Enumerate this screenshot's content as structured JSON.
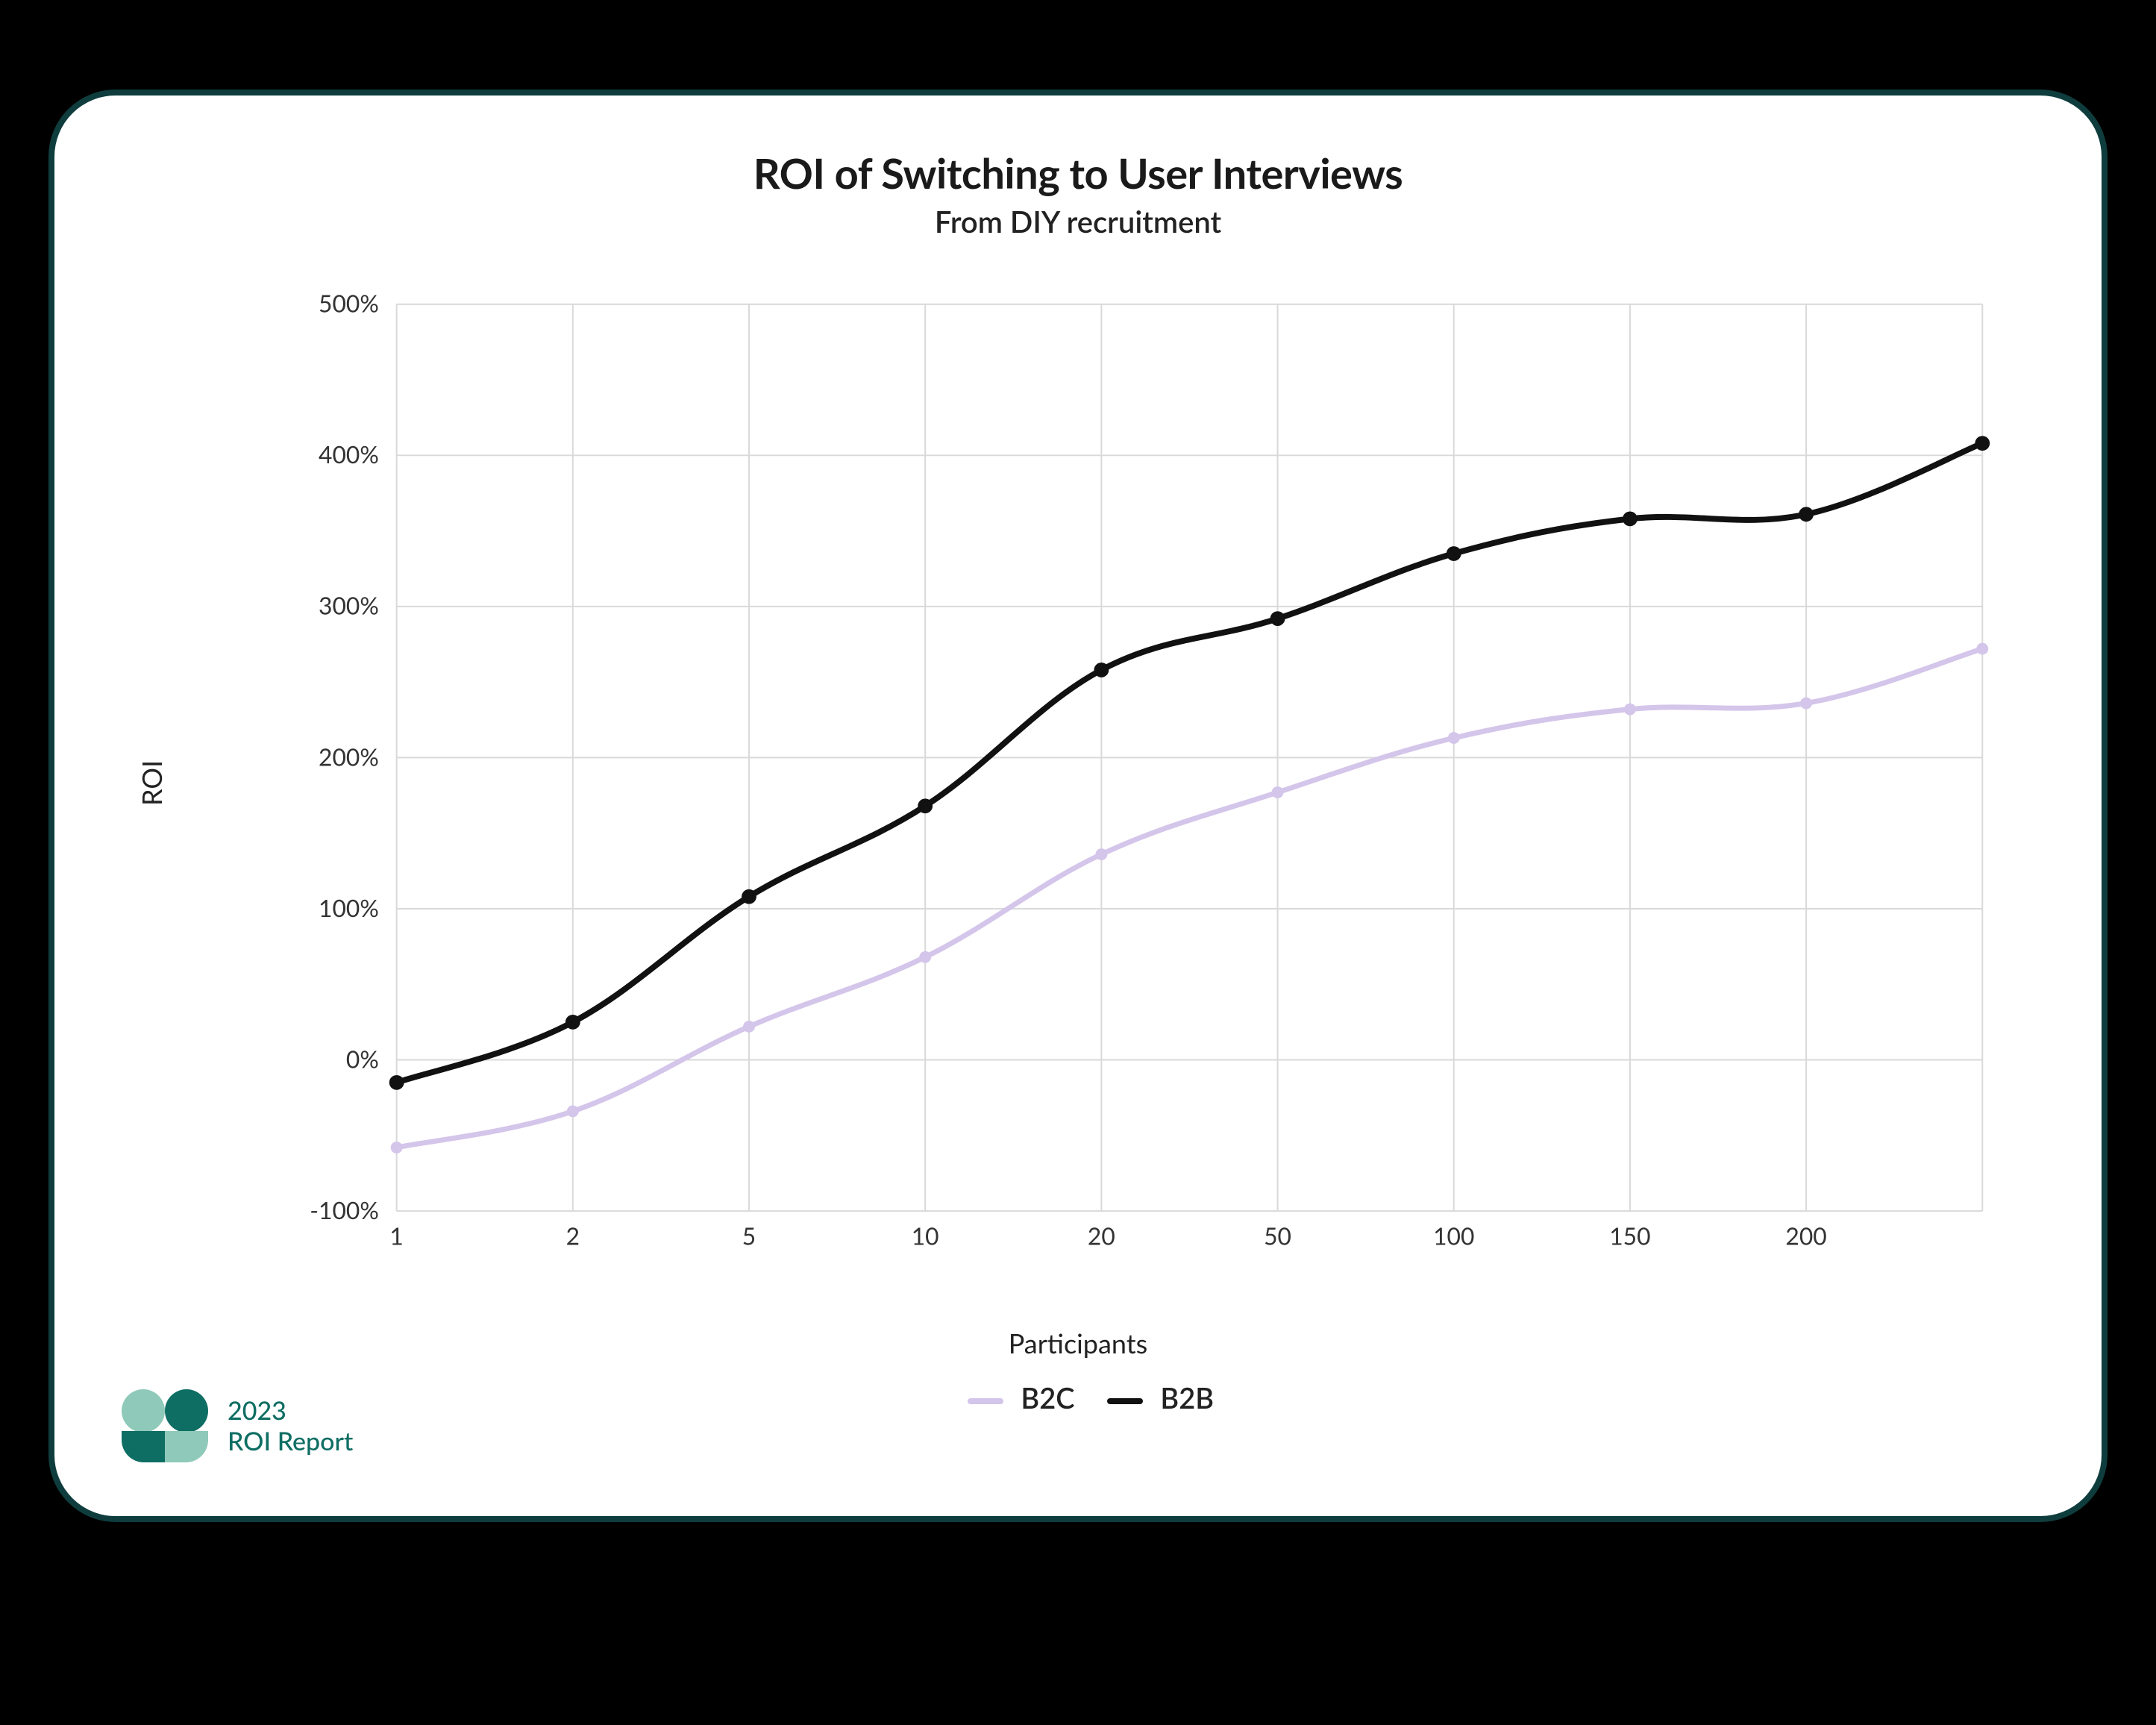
{
  "chart_data": {
    "type": "line",
    "title": "ROI of Switching to User Interviews",
    "subtitle": "From DIY recruitment",
    "xlabel": "Participants",
    "ylabel": "ROI",
    "x_ticks": [
      1,
      2,
      5,
      10,
      20,
      50,
      100,
      150,
      200
    ],
    "x_tick_labels": [
      "1",
      "2",
      "5",
      "10",
      "20",
      "50",
      "100",
      "150",
      "200"
    ],
    "y_ticks": [
      -100,
      0,
      100,
      200,
      300,
      400,
      500
    ],
    "y_tick_labels": [
      "-100%",
      "0%",
      "100%",
      "200%",
      "300%",
      "400%",
      "500%"
    ],
    "ylim": [
      -100,
      500
    ],
    "series": [
      {
        "name": "B2C",
        "color": "#d4c5ea",
        "x": [
          1,
          2,
          5,
          10,
          20,
          50,
          100,
          150,
          200,
          300
        ],
        "values": [
          -58,
          -34,
          22,
          68,
          136,
          177,
          213,
          232,
          236,
          272
        ]
      },
      {
        "name": "B2B",
        "color": "#111111",
        "x": [
          1,
          2,
          5,
          10,
          20,
          50,
          100,
          150,
          200,
          300
        ],
        "values": [
          -15,
          25,
          108,
          168,
          258,
          292,
          335,
          358,
          361,
          408
        ]
      }
    ],
    "x_scale": "categorical_linear_positions"
  },
  "legend": {
    "b2c_label": "B2C",
    "b2b_label": "B2B"
  },
  "brand": {
    "year": "2023",
    "report_label": "ROI Report",
    "colors": {
      "dark": "#0f6e63",
      "light": "#8fc9b9"
    }
  }
}
